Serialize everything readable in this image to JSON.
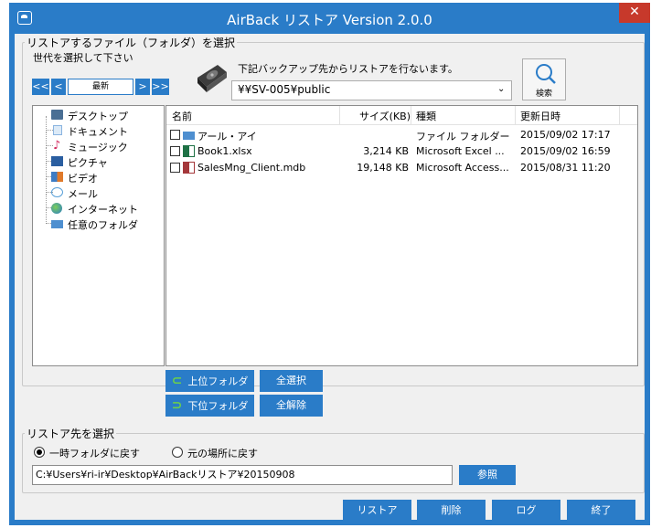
{
  "window": {
    "title": "AirBack リストア   Version 2.0.0",
    "close_glyph": "✕"
  },
  "source": {
    "group_label": "リストアするファイル（フォルダ）を選択",
    "generation_label": "世代を選択して下さい",
    "nav": {
      "first": "<<",
      "prev": "<",
      "current": "最新",
      "next": ">",
      "last": ">>"
    },
    "backup_message": "下記バックアップ先からリストアを行ないます。",
    "backup_path": "¥¥SV-005¥public",
    "search_label": "検索"
  },
  "tree": {
    "items": [
      {
        "label": "デスクトップ",
        "icon": "desktop-icon",
        "color": "#4a6f94"
      },
      {
        "label": "ドキュメント",
        "icon": "document-icon",
        "color": "#8ab4e0"
      },
      {
        "label": "ミュージック",
        "icon": "music-icon",
        "color": "#d0245a"
      },
      {
        "label": "ピクチャ",
        "icon": "picture-icon",
        "color": "#2a5ea0"
      },
      {
        "label": "ビデオ",
        "icon": "video-icon",
        "color": "#3c7cc4"
      },
      {
        "label": "メール",
        "icon": "mail-icon",
        "color": "#5aa0d8"
      },
      {
        "label": "インターネット",
        "icon": "internet-icon",
        "color": "#3aa04a"
      },
      {
        "label": "任意のフォルダ",
        "icon": "folder-icon",
        "color": "#4e8fd0"
      }
    ]
  },
  "file_list": {
    "columns": [
      "名前",
      "サイズ(KB)",
      "種類",
      "更新日時"
    ],
    "rows": [
      {
        "name": "アール・アイ",
        "size": "",
        "type": "ファイル フォルダー",
        "modified": "2015/09/02 17:17",
        "icon": "folder-icon"
      },
      {
        "name": "Book1.xlsx",
        "size": "3,214 KB",
        "type": "Microsoft Excel ...",
        "modified": "2015/09/02 16:59",
        "icon": "excel-file-icon"
      },
      {
        "name": "SalesMng_Client.mdb",
        "size": "19,148 KB",
        "type": "Microsoft Access...",
        "modified": "2015/08/31 11:20",
        "icon": "access-file-icon"
      }
    ]
  },
  "list_actions": {
    "up_folder": "上位フォルダ",
    "down_folder": "下位フォルダ",
    "select_all": "全選択",
    "deselect_all": "全解除"
  },
  "destination": {
    "group_label": "リストア先を選択",
    "option_temp": "一時フォルダに戻す",
    "option_original": "元の場所に戻す",
    "selected": "option_temp",
    "path": "C:¥Users¥ri-ir¥Desktop¥AirBackリストア¥20150908",
    "browse_label": "参照"
  },
  "footer": {
    "restore": "リストア",
    "delete": "削除",
    "log": "ログ",
    "exit": "終了"
  },
  "colors": {
    "accent": "#2a7cc8",
    "close": "#c7392b",
    "arrow_green": "#6bd04a"
  }
}
